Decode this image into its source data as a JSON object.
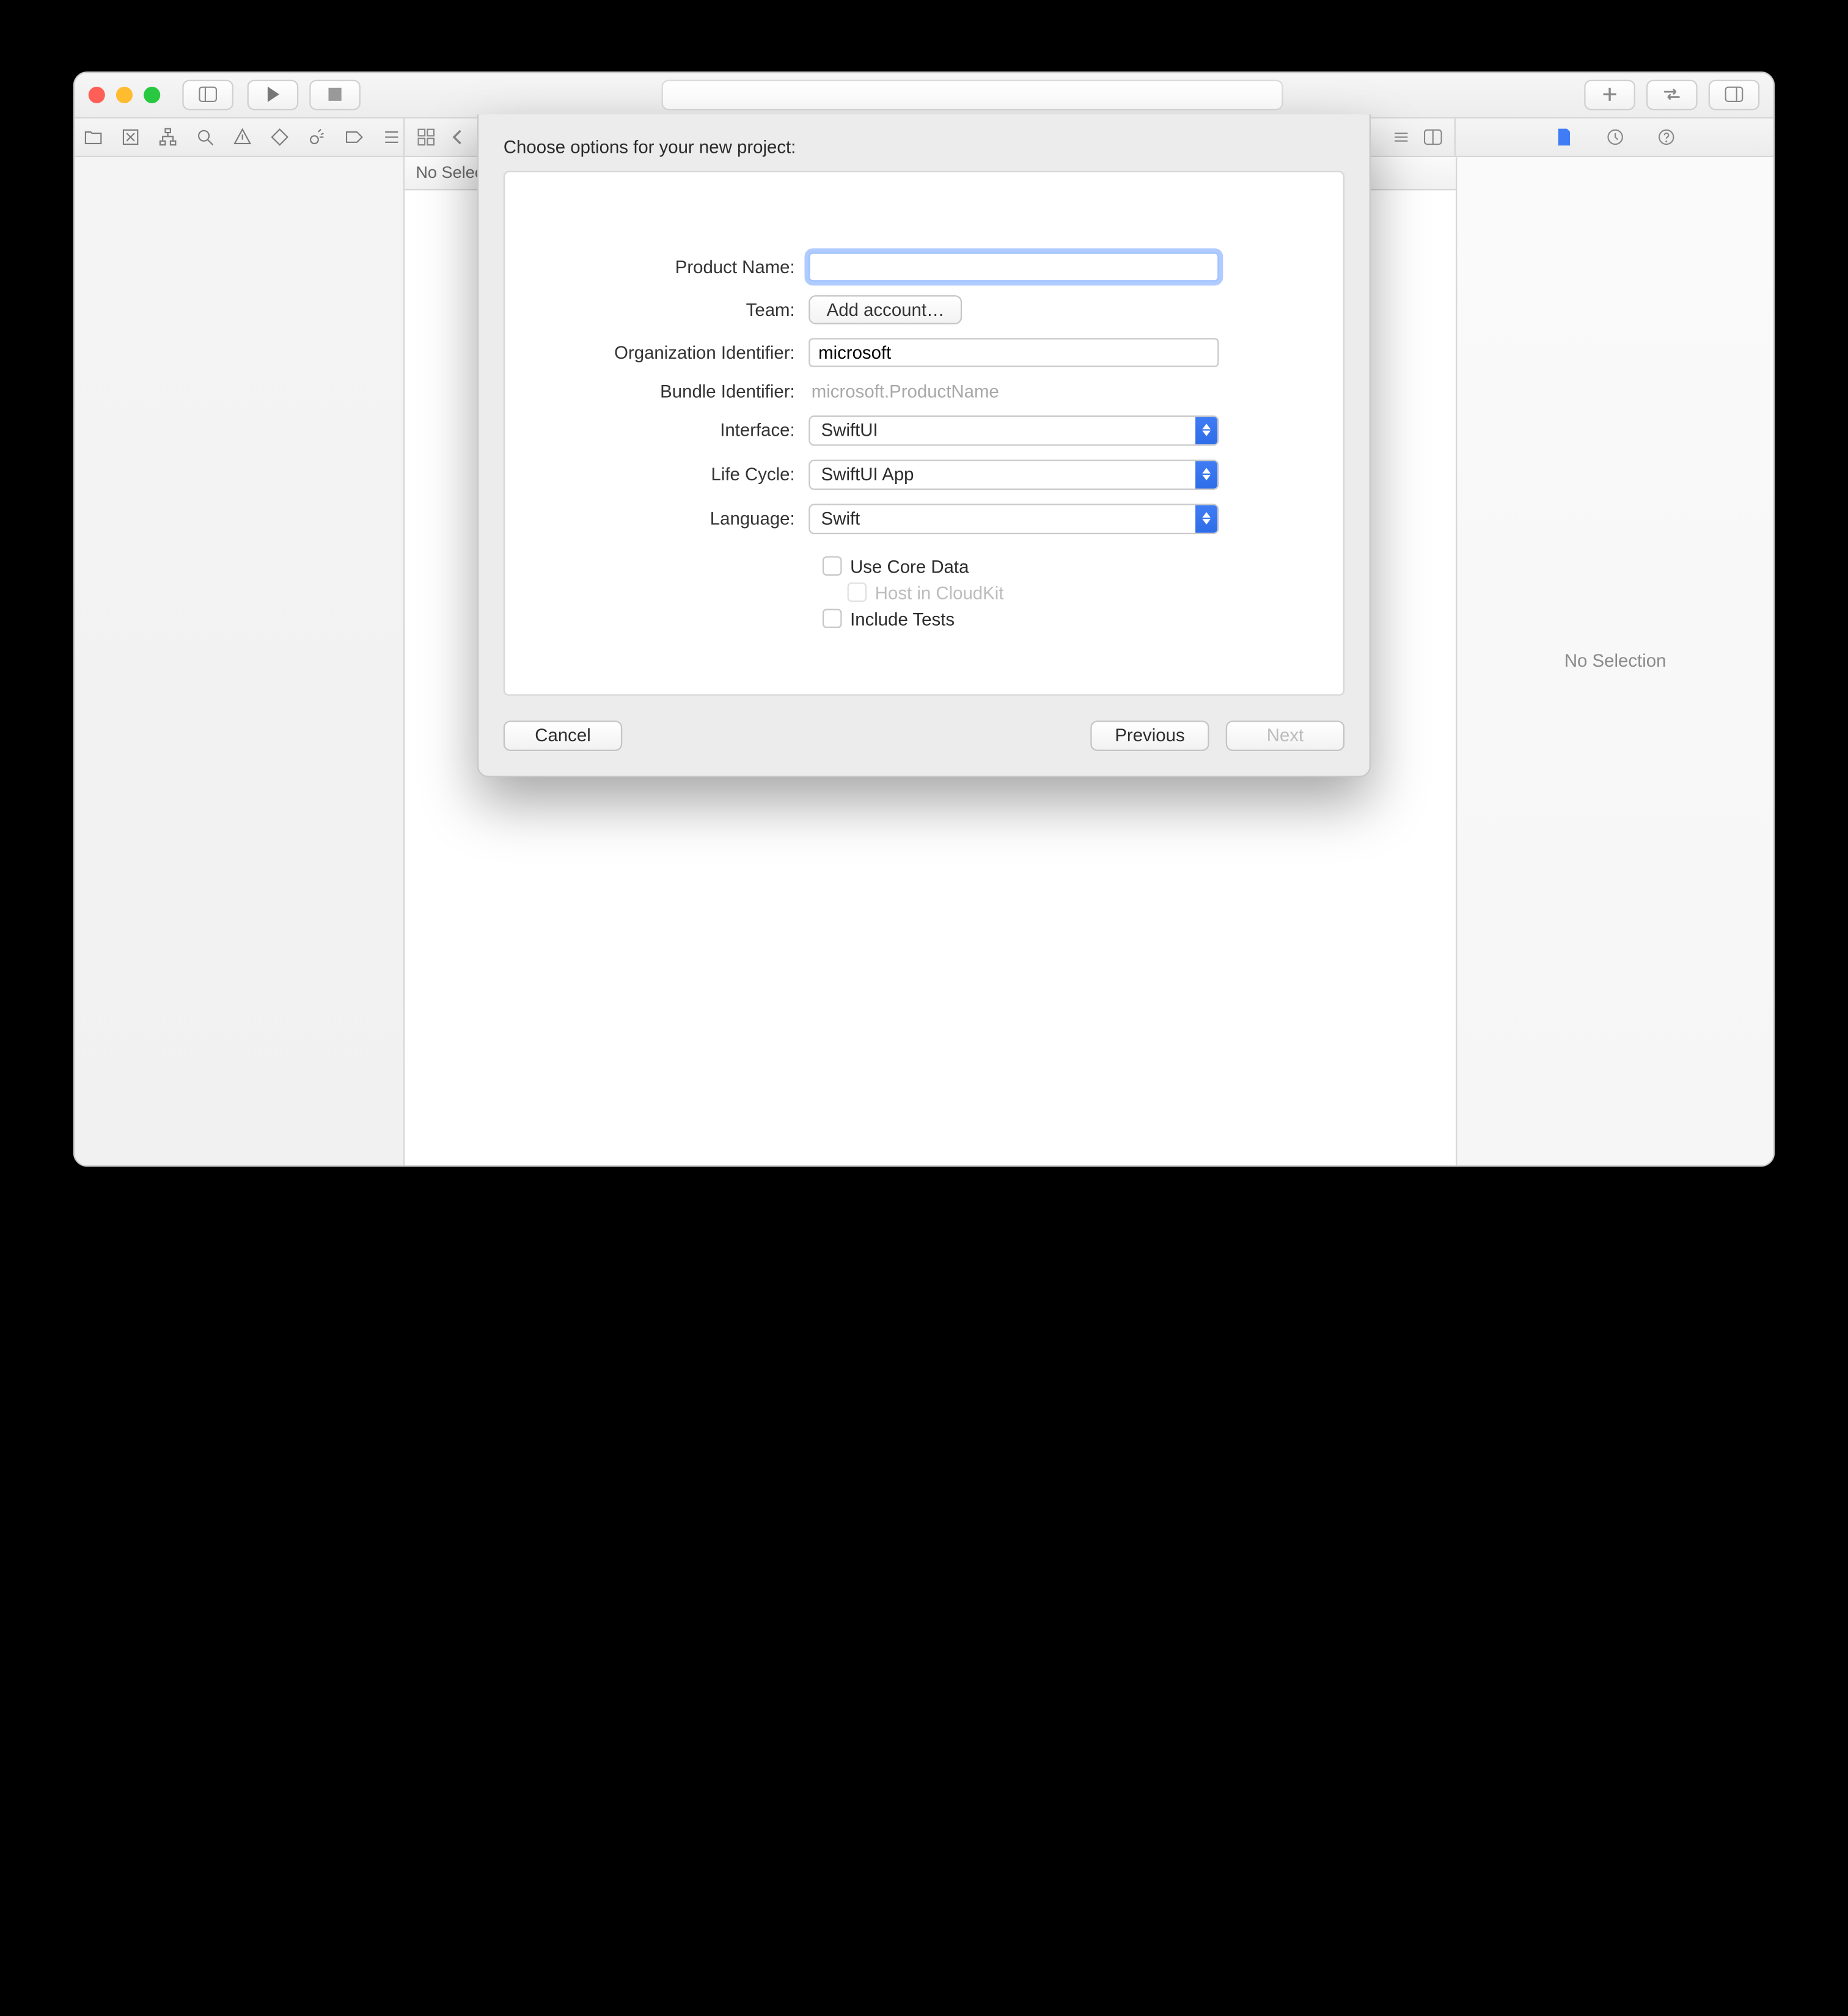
{
  "jumpbar": {
    "text": "No Selection"
  },
  "inspector": {
    "empty_text": "No Selection"
  },
  "sheet": {
    "title": "Choose options for your new project:",
    "labels": {
      "product_name": "Product Name:",
      "team": "Team:",
      "org_id": "Organization Identifier:",
      "bundle_id": "Bundle Identifier:",
      "interface": "Interface:",
      "life_cycle": "Life Cycle:",
      "language": "Language:"
    },
    "values": {
      "product_name": "",
      "team_button": "Add account…",
      "org_id": "microsoft",
      "bundle_id": "microsoft.ProductName",
      "interface": "SwiftUI",
      "life_cycle": "SwiftUI App",
      "language": "Swift"
    },
    "checks": {
      "core_data": "Use Core Data",
      "cloudkit": "Host in CloudKit",
      "tests": "Include Tests"
    },
    "buttons": {
      "cancel": "Cancel",
      "previous": "Previous",
      "next": "Next"
    }
  }
}
